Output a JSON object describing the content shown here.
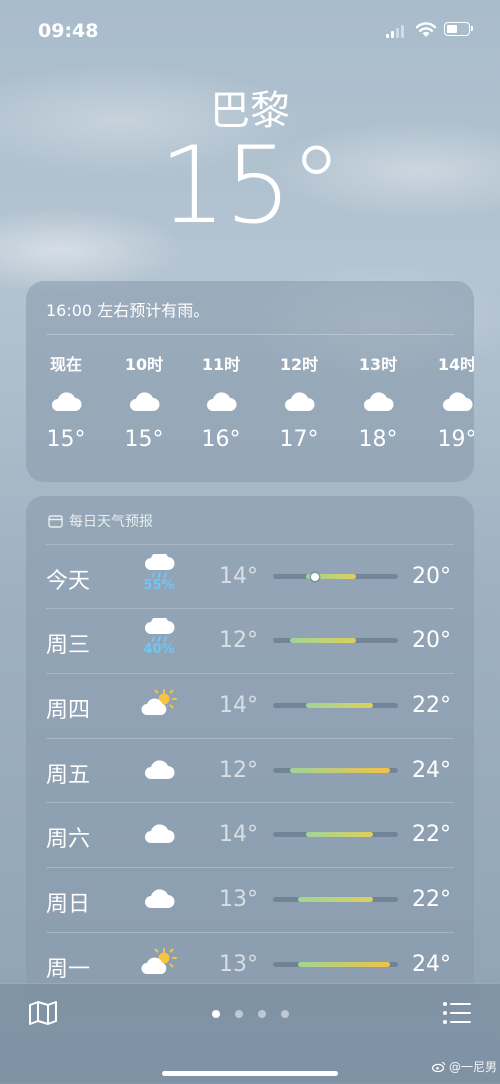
{
  "status_bar": {
    "time": "09:48"
  },
  "location": {
    "city": "巴黎",
    "temperature": "15°"
  },
  "hourly": {
    "summary": "16:00 左右预计有雨。",
    "items": [
      {
        "label": "现在",
        "icon": "cloud-icon",
        "temp": "15°"
      },
      {
        "label": "10时",
        "icon": "cloud-icon",
        "temp": "15°"
      },
      {
        "label": "11时",
        "icon": "cloud-icon",
        "temp": "16°"
      },
      {
        "label": "12时",
        "icon": "cloud-icon",
        "temp": "17°"
      },
      {
        "label": "13时",
        "icon": "cloud-icon",
        "temp": "18°"
      },
      {
        "label": "14时",
        "icon": "cloud-icon",
        "temp": "19°"
      }
    ]
  },
  "daily": {
    "header": "每日天气预报",
    "days": [
      {
        "day": "今天",
        "icon": "cloud-rain-icon",
        "precip": "55%",
        "low": "14°",
        "high": "20°",
        "range": [
          14,
          20
        ],
        "current": 15
      },
      {
        "day": "周三",
        "icon": "cloud-rain-icon",
        "precip": "40%",
        "low": "12°",
        "high": "20°",
        "range": [
          12,
          20
        ]
      },
      {
        "day": "周四",
        "icon": "partly-sunny-icon",
        "precip": "",
        "low": "14°",
        "high": "22°",
        "range": [
          14,
          22
        ]
      },
      {
        "day": "周五",
        "icon": "cloud-icon",
        "precip": "",
        "low": "12°",
        "high": "24°",
        "range": [
          12,
          24
        ]
      },
      {
        "day": "周六",
        "icon": "cloud-icon",
        "precip": "",
        "low": "14°",
        "high": "22°",
        "range": [
          14,
          22
        ]
      },
      {
        "day": "周日",
        "icon": "cloud-icon",
        "precip": "",
        "low": "13°",
        "high": "22°",
        "range": [
          13,
          22
        ]
      },
      {
        "day": "周一",
        "icon": "partly-sunny-icon",
        "precip": "",
        "low": "13°",
        "high": "24°",
        "range": [
          13,
          24
        ]
      }
    ],
    "scale": [
      10,
      25
    ]
  },
  "page_indicator": {
    "count": 4,
    "active": 0
  },
  "watermark": "@一尼男",
  "colors": {
    "precip": "#6fc7f7",
    "bar_cool": "#9fd49a",
    "bar_warm": "#f0c245"
  }
}
